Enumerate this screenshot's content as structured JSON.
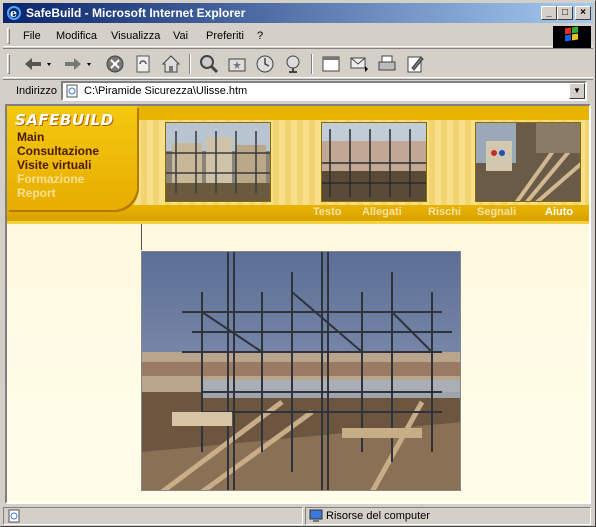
{
  "window": {
    "title": "SafeBuild - Microsoft Internet Explorer",
    "min_label": "_",
    "max_label": "□",
    "close_label": "×"
  },
  "menu": [
    "File",
    "Modifica",
    "Visualizza",
    "Vai",
    "Preferiti",
    "?"
  ],
  "toolbar": {
    "icons": [
      "back-icon",
      "forward-icon",
      "stop-icon",
      "refresh-icon",
      "home-icon",
      "search-icon",
      "favorites-icon",
      "history-icon",
      "channels-icon",
      "fullscreen-icon",
      "mail-icon",
      "print-icon",
      "edit-icon"
    ]
  },
  "address": {
    "label": "Indirizzo",
    "value": "C:\\Piramide Sicurezza\\Ulisse.htm"
  },
  "site": {
    "brand": "SAFEBUILD",
    "nav": [
      "Main",
      "Consultazione",
      "Visite virtuali",
      "Formazione",
      "Report"
    ],
    "tabs": [
      "Testo",
      "Allegati",
      "Rischi",
      "Segnali",
      "Aiuto"
    ]
  },
  "status": {
    "zone": "Risorse del computer"
  }
}
